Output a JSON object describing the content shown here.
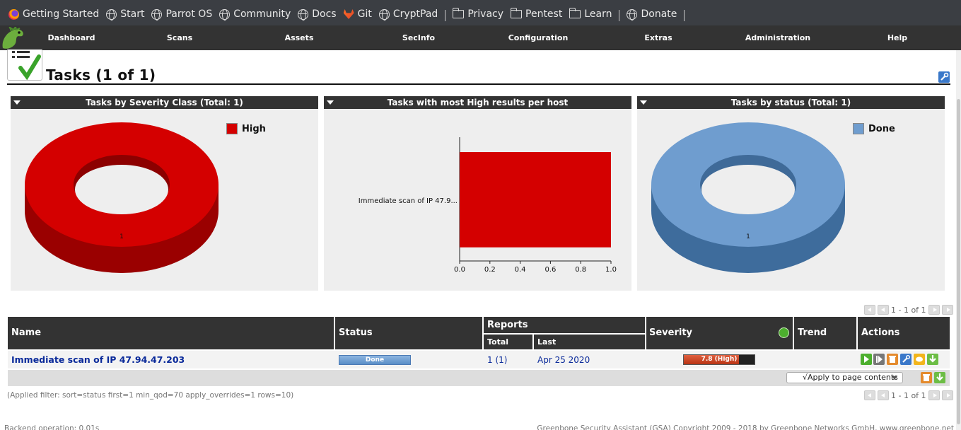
{
  "bookmarks": [
    {
      "label": "Getting Started",
      "icon": "firefox-icon"
    },
    {
      "label": "Start",
      "icon": "globe-icon"
    },
    {
      "label": "Parrot OS",
      "icon": "globe-icon"
    },
    {
      "label": "Community",
      "icon": "globe-icon"
    },
    {
      "label": "Docs",
      "icon": "globe-icon"
    },
    {
      "label": "Git",
      "icon": "gitlab-icon"
    },
    {
      "label": "CryptPad",
      "icon": "globe-icon"
    },
    {
      "label": "Privacy",
      "icon": "folder-icon"
    },
    {
      "label": "Pentest",
      "icon": "folder-icon"
    },
    {
      "label": "Learn",
      "icon": "folder-icon"
    },
    {
      "label": "Donate",
      "icon": "globe-icon"
    }
  ],
  "nav": {
    "items": [
      "Dashboard",
      "Scans",
      "Assets",
      "SecInfo",
      "Configuration",
      "Extras",
      "Administration",
      "Help"
    ]
  },
  "page": {
    "title": "Tasks (1 of 1)"
  },
  "panels": {
    "severity": {
      "title": "Tasks by Severity Class (Total: 1)",
      "legend": "High",
      "color": "#d40000",
      "slice_label": "1"
    },
    "high_results": {
      "title": "Tasks with most High results per host"
    },
    "status": {
      "title": "Tasks by status (Total: 1)",
      "legend": "Done",
      "color": "#6f9dcf",
      "slice_label": "1"
    }
  },
  "chart_data": [
    {
      "type": "pie",
      "title": "Tasks by Severity Class (Total: 1)",
      "categories": [
        "High"
      ],
      "values": [
        1
      ],
      "colors": [
        "#d40000"
      ],
      "legend": "top-right"
    },
    {
      "type": "bar",
      "orientation": "horizontal",
      "title": "Tasks with most High results per host",
      "categories": [
        "Immediate scan of IP 47.9..."
      ],
      "values": [
        1.0
      ],
      "xlim": [
        0,
        1.0
      ],
      "xticks": [
        "0.0",
        "0.2",
        "0.4",
        "0.6",
        "0.8",
        "1.0"
      ],
      "color": "#d40000"
    },
    {
      "type": "pie",
      "title": "Tasks by status (Total: 1)",
      "categories": [
        "Done"
      ],
      "values": [
        1
      ],
      "colors": [
        "#6f9dcf"
      ],
      "legend": "top-right"
    }
  ],
  "pagination": {
    "text": "1 - 1 of 1"
  },
  "table": {
    "headers": {
      "name": "Name",
      "status": "Status",
      "reports": "Reports",
      "total": "Total",
      "last": "Last",
      "severity": "Severity",
      "trend": "Trend",
      "actions": "Actions"
    },
    "rows": [
      {
        "name": "Immediate scan of IP 47.94.47.203",
        "status": "Done",
        "progress": 1.0,
        "total": "1 (1)",
        "last": "Apr 25 2020",
        "severity": "7.8 (High)",
        "severity_value": 7.8,
        "trend": ""
      }
    ],
    "apply_label": "√Apply to page contents"
  },
  "filter_text": "(Applied filter: sort=status first=1 min_qod=70 apply_overrides=1 rows=10)",
  "status_bar": {
    "left": "Backend operation: 0.01s",
    "right": "Greenbone Security Assistant (GSA) Copyright 2009 - 2018 by Greenbone Networks GmbH, www.greenbone.net"
  }
}
